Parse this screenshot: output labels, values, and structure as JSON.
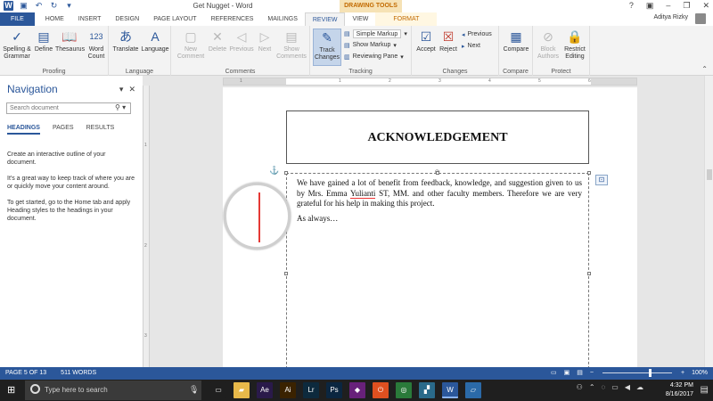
{
  "window": {
    "title": "Get Nugget - Word",
    "context_tab_group": "DRAWING TOOLS",
    "help": "?",
    "user": "Aditya Rizky"
  },
  "tabs": [
    {
      "label": "FILE"
    },
    {
      "label": "HOME"
    },
    {
      "label": "INSERT"
    },
    {
      "label": "DESIGN"
    },
    {
      "label": "PAGE LAYOUT"
    },
    {
      "label": "REFERENCES"
    },
    {
      "label": "MAILINGS"
    },
    {
      "label": "REVIEW"
    },
    {
      "label": "VIEW"
    },
    {
      "label": "FORMAT"
    }
  ],
  "ribbon": {
    "proofing": {
      "label": "Proofing",
      "spelling": "Spelling &",
      "grammar": "Grammar",
      "define": "Define",
      "thesaurus": "Thesaurus",
      "word": "Word",
      "count": "Count"
    },
    "language": {
      "label": "Language",
      "translate": "Translate",
      "language": "Language"
    },
    "comments": {
      "label": "Comments",
      "new": "New",
      "comment": "Comment",
      "delete": "Delete",
      "previous": "Previous",
      "next": "Next",
      "show": "Show",
      "comments": "Comments"
    },
    "tracking": {
      "label": "Tracking",
      "track": "Track",
      "changes": "Changes",
      "simple_markup": "Simple Markup",
      "show_markup": "Show Markup",
      "reviewing_pane": "Reviewing Pane"
    },
    "changes": {
      "label": "Changes",
      "accept": "Accept",
      "reject": "Reject",
      "previous": "Previous",
      "next": "Next"
    },
    "compare": {
      "label": "Compare",
      "compare": "Compare"
    },
    "protect": {
      "label": "Protect",
      "block": "Block",
      "authors": "Authors",
      "restrict": "Restrict",
      "editing": "Editing"
    }
  },
  "navigation": {
    "title": "Navigation",
    "search_placeholder": "Search document",
    "tabs": [
      "HEADINGS",
      "PAGES",
      "RESULTS"
    ],
    "p1": "Create an interactive outline of your document.",
    "p2": "It's a great way to keep track of where you are or quickly move your content around.",
    "p3": "To get started, go to the Home tab and apply Heading styles to the headings in your document."
  },
  "ruler": {
    "h_labels": [
      "1",
      "1",
      "2",
      "3",
      "4",
      "5",
      "6"
    ],
    "v_labels": [
      "1",
      "2",
      "3"
    ]
  },
  "document": {
    "heading": "ACKNOWLEDGEMENT",
    "para1_before": "We have gained a lot of benefit from feedback, knowledge, and suggestion given to us by Mrs. Emma ",
    "para1_misspelled": "Yulianti",
    "para1_after": " ST, MM. and other faculty members. Therefore we are very grateful for his help in making this project.",
    "para2": "As always…"
  },
  "status": {
    "page": "PAGE 5 OF 13",
    "words": "511 WORDS",
    "zoom": "100%",
    "zoom_out": "−",
    "zoom_in": "+"
  },
  "taskbar": {
    "search_placeholder": "Type here to search",
    "apps": [
      {
        "name": "task-view",
        "glyph": "▭",
        "color": "#1f1f1f"
      },
      {
        "name": "file-explorer",
        "glyph": "▰",
        "color": "#e8b94a"
      },
      {
        "name": "after-effects",
        "glyph": "Ae",
        "color": "#2a1a4a"
      },
      {
        "name": "illustrator",
        "glyph": "Ai",
        "color": "#3a2200"
      },
      {
        "name": "lightroom",
        "glyph": "Lr",
        "color": "#0d2a3d"
      },
      {
        "name": "photoshop",
        "glyph": "Ps",
        "color": "#0b2640"
      },
      {
        "name": "visual-studio",
        "glyph": "◆",
        "color": "#68217a"
      },
      {
        "name": "power-app",
        "glyph": "⏻",
        "color": "#e05020"
      },
      {
        "name": "chrome",
        "glyph": "◎",
        "color": "#2a7a3a"
      },
      {
        "name": "notes-app",
        "glyph": "▞",
        "color": "#2a6a8a"
      },
      {
        "name": "word",
        "glyph": "W",
        "color": "#2b579a"
      },
      {
        "name": "other-app",
        "glyph": "▱",
        "color": "#2b6aa8"
      }
    ],
    "time": "4:32 PM",
    "date": "8/16/2017"
  },
  "colors": {
    "accent": "#2b579a",
    "status_bar": "#2b579a",
    "contextual": "#c26a00"
  }
}
